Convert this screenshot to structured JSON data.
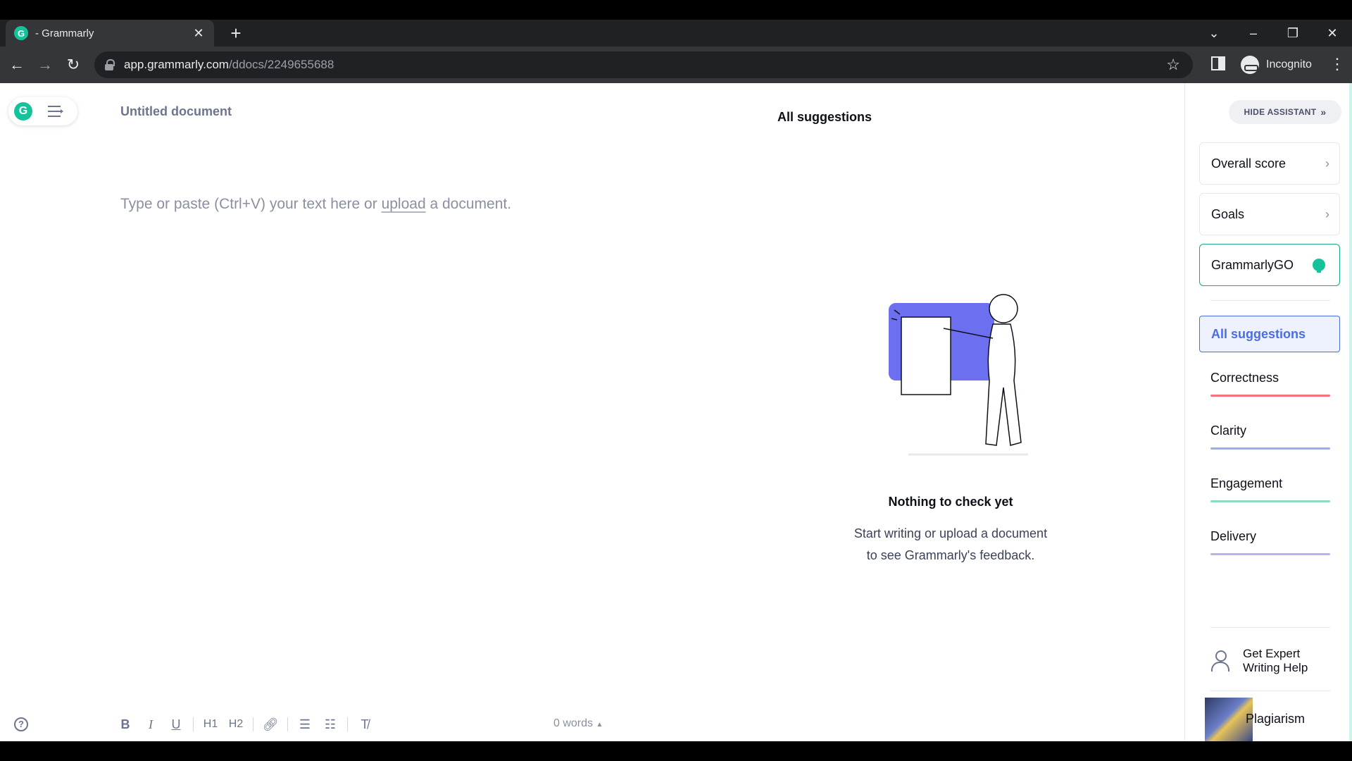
{
  "browser": {
    "tab_title": "- Grammarly",
    "tab_favicon_letter": "G",
    "url_host": "app.grammarly.com",
    "url_path": "/ddocs/2249655688",
    "incognito_label": "Incognito"
  },
  "editor": {
    "logo_letter": "G",
    "doc_title": "Untitled document",
    "placeholder_before": "Type or paste (Ctrl+V) your text here or ",
    "placeholder_link": "upload",
    "placeholder_after": " a document.",
    "word_count": "0 words"
  },
  "center": {
    "heading": "All suggestions",
    "empty_title": "Nothing to check yet",
    "empty_line1": "Start writing or upload a document",
    "empty_line2": "to see Grammarly's feedback."
  },
  "toolbar": {
    "bold": "B",
    "italic": "I",
    "underline": "U",
    "h1": "H1",
    "h2": "H2",
    "help": "?"
  },
  "assistant": {
    "hide_label": "HIDE ASSISTANT",
    "cards": {
      "overall": "Overall score",
      "goals": "Goals",
      "go": "GrammarlyGO"
    },
    "active_tab": "All suggestions",
    "categories": [
      {
        "label": "Correctness",
        "color": "#f5707a"
      },
      {
        "label": "Clarity",
        "color": "#8fb3f0"
      },
      {
        "label": "Engagement",
        "color": "#8fd9c1"
      },
      {
        "label": "Delivery",
        "color": "#b7b3f2"
      }
    ],
    "expert_line1": "Get Expert",
    "expert_line2": "Writing Help",
    "plagiarism": "Plagiarism"
  },
  "colors": {
    "brand_green": "#15c39a",
    "accent_blue": "#4a6ee0"
  }
}
